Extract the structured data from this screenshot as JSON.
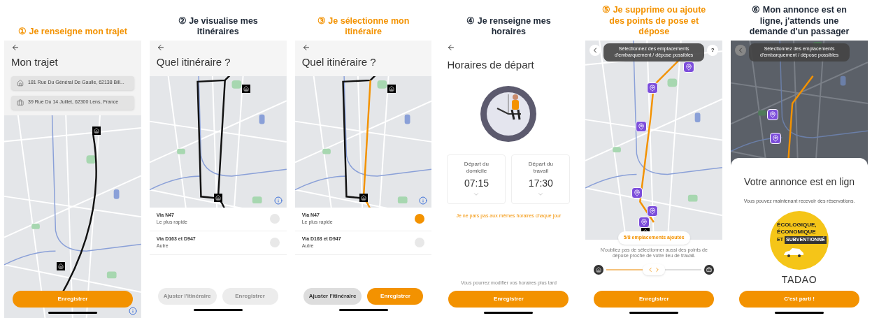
{
  "steps": [
    {
      "number": "①",
      "title": "Je renseigne mon trajet",
      "color": "#f39200",
      "screen": {
        "kind": "trajet",
        "title": "Mon trajet",
        "fields": [
          {
            "kind": "home",
            "value": "181 Rue Du Général De Gaulle, 62138 Bill..."
          },
          {
            "kind": "work",
            "value": "39 Rue Du 14 Juillet, 62300 Lens, France"
          }
        ],
        "buttons": [
          {
            "label": "Enregistrer",
            "kind": "primary",
            "disabled": false
          }
        ]
      }
    },
    {
      "number": "②",
      "title": "Je visualise mes itinéraires",
      "color": "#1f2937",
      "screen": {
        "kind": "itineraire",
        "title": "Quel itinéraire ?",
        "routes": [
          {
            "name": "Via N47",
            "description": "Le plus rapide",
            "selected": false
          },
          {
            "name": "Via D163 et D947",
            "description": "Autre",
            "selected": false
          }
        ],
        "buttons": [
          {
            "label": "Ajuster l'itinéraire",
            "kind": "secondary",
            "disabled": true
          },
          {
            "label": "Enregistrer",
            "kind": "primary",
            "disabled": true
          }
        ]
      }
    },
    {
      "number": "③",
      "title": "Je sélectionne mon itinéraire",
      "color": "#f39200",
      "screen": {
        "kind": "itineraire",
        "title": "Quel itinéraire ?",
        "routes": [
          {
            "name": "Via N47",
            "description": "Le plus rapide",
            "selected": true
          },
          {
            "name": "Via D163 et D947",
            "description": "Autre",
            "selected": false
          }
        ],
        "buttons": [
          {
            "label": "Ajuster l'itinéraire",
            "kind": "secondary",
            "disabled": false
          },
          {
            "label": "Enregistrer",
            "kind": "primary",
            "disabled": false
          }
        ]
      }
    },
    {
      "number": "④",
      "title": "Je renseigne mes horaires",
      "color": "#1f2937",
      "screen": {
        "kind": "horaires",
        "title": "Horaires de départ",
        "times": [
          {
            "label": "Départ du domicile",
            "value": "07:15"
          },
          {
            "label": "Départ du travail",
            "value": "17:30"
          }
        ],
        "link": "Je ne pars pas aux mêmes horaires chaque jour",
        "note": "Vous pourrez modifier vos horaires plus tard",
        "buttons": [
          {
            "label": "Enregistrer",
            "kind": "primary",
            "disabled": false
          }
        ]
      }
    },
    {
      "number": "⑤",
      "title": "Je supprime ou ajoute des points de pose et dépose",
      "color": "#f39200",
      "screen": {
        "kind": "points",
        "tooltip": "Sélectionnez des emplacements d'embarquement / dépose possibles",
        "help": "?",
        "count": "5/8 emplacements ajoutés",
        "hint": "N'oubliez pas de sélectionner aussi des points de dépose proche de votre lieu de travail.",
        "slider": {
          "level": 0.5
        },
        "buttons": [
          {
            "label": "Enregistrer",
            "kind": "primary",
            "disabled": false
          }
        ]
      }
    },
    {
      "number": "⑥",
      "title": "Mon annonce est en ligne, j'attends une demande d'un passager",
      "color": "#1f2937",
      "screen": {
        "kind": "annonce",
        "tooltip": "Sélectionnez des emplacements d'embarquement / dépose possibles",
        "title": "Votre annonce est en lign",
        "subtitle": "Vous pouvez maintenant recevoir des réservations.",
        "badge": {
          "lines": [
            "ÉCOLOGIQUE,",
            "ÉCONOMIQUE"
          ],
          "tag_prefix": "ET",
          "tag": "SUBVENTIONNÉ"
        },
        "logo": "TADAO",
        "buttons": [
          {
            "label": "C'est parti !",
            "kind": "primary",
            "disabled": false
          }
        ]
      }
    }
  ]
}
